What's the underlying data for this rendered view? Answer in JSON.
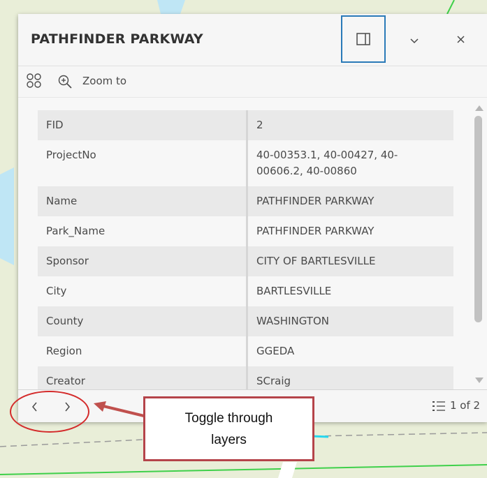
{
  "popup": {
    "title": "PATHFINDER PARKWAY",
    "toolbar": {
      "zoom_label": "Zoom to"
    },
    "attributes": [
      {
        "key": "FID",
        "value": "2"
      },
      {
        "key": "ProjectNo",
        "value": "40-00353.1, 40-00427, 40-00606.2, 40-00860"
      },
      {
        "key": "Name",
        "value": "PATHFINDER PARKWAY"
      },
      {
        "key": "Park_Name",
        "value": "PATHFINDER PARKWAY"
      },
      {
        "key": "Sponsor",
        "value": "CITY OF BARTLESVILLE"
      },
      {
        "key": "City",
        "value": "BARTLESVILLE"
      },
      {
        "key": "County",
        "value": "WASHINGTON"
      },
      {
        "key": "Region",
        "value": "GGEDA"
      },
      {
        "key": "Creator",
        "value": "SCraig"
      }
    ],
    "footer": {
      "pager": "1 of 2"
    }
  },
  "annotation": {
    "callout_text": "Toggle through layers"
  },
  "colors": {
    "map_background": "#e8ecd7",
    "accent_blue": "#2a7ab8",
    "callout_red": "#d42b2b",
    "callout_border": "#b5444a"
  },
  "icons": [
    "apps-icon",
    "zoom-to-icon",
    "dock-icon",
    "chevron-down-icon",
    "close-icon",
    "chevron-left-icon",
    "chevron-right-icon",
    "feature-list-icon"
  ]
}
